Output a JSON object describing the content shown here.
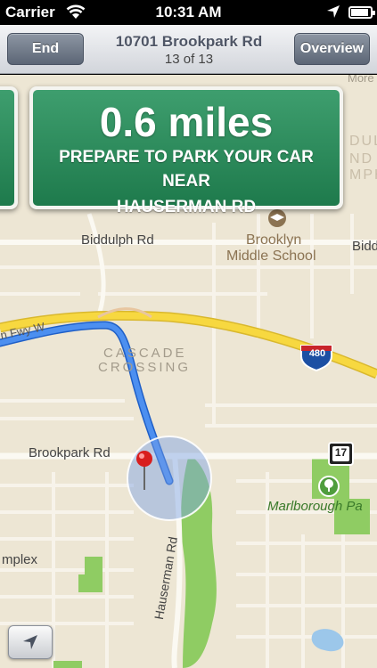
{
  "status_bar": {
    "carrier": "Carrier",
    "time": "10:31 AM",
    "battery_level": 0.92
  },
  "nav": {
    "end_label": "End",
    "overview_label": "Overview",
    "title": "10701 Brookpark Rd",
    "step": "13 of 13"
  },
  "sign": {
    "distance": "0.6 miles",
    "instruction_line1": "PREPARE TO PARK YOUR CAR NEAR",
    "instruction_line2": "HAUSERMAN RD"
  },
  "map": {
    "labels": {
      "biddulph": "Biddulph Rd",
      "biddulph_right": "Bidd",
      "brooklyn1": "Brooklyn",
      "brooklyn2": "Middle School",
      "cascade1": "CASCADE",
      "cascade2": "CROSSING",
      "brookpark": "Brookpark Rd",
      "marlborough": "Marlborough Pa",
      "complex": "mplex",
      "hauserman": "Hauserman Rd",
      "freeway": "n Fwy W",
      "top_right1": "More",
      "top_right2": "DUL",
      "top_right3": "ND",
      "top_right4": "MPH"
    },
    "shields": {
      "interstate": "480",
      "state_route": "17"
    },
    "colors": {
      "route": "#2f76e6",
      "highway": "#f4d23a",
      "park": "#8fcc63",
      "sign_green": "#2a8a5a"
    }
  },
  "icons": {
    "locate": "location-arrow-icon",
    "school": "school-icon",
    "park": "park-tree-icon",
    "pin": "dropped-pin-icon"
  }
}
